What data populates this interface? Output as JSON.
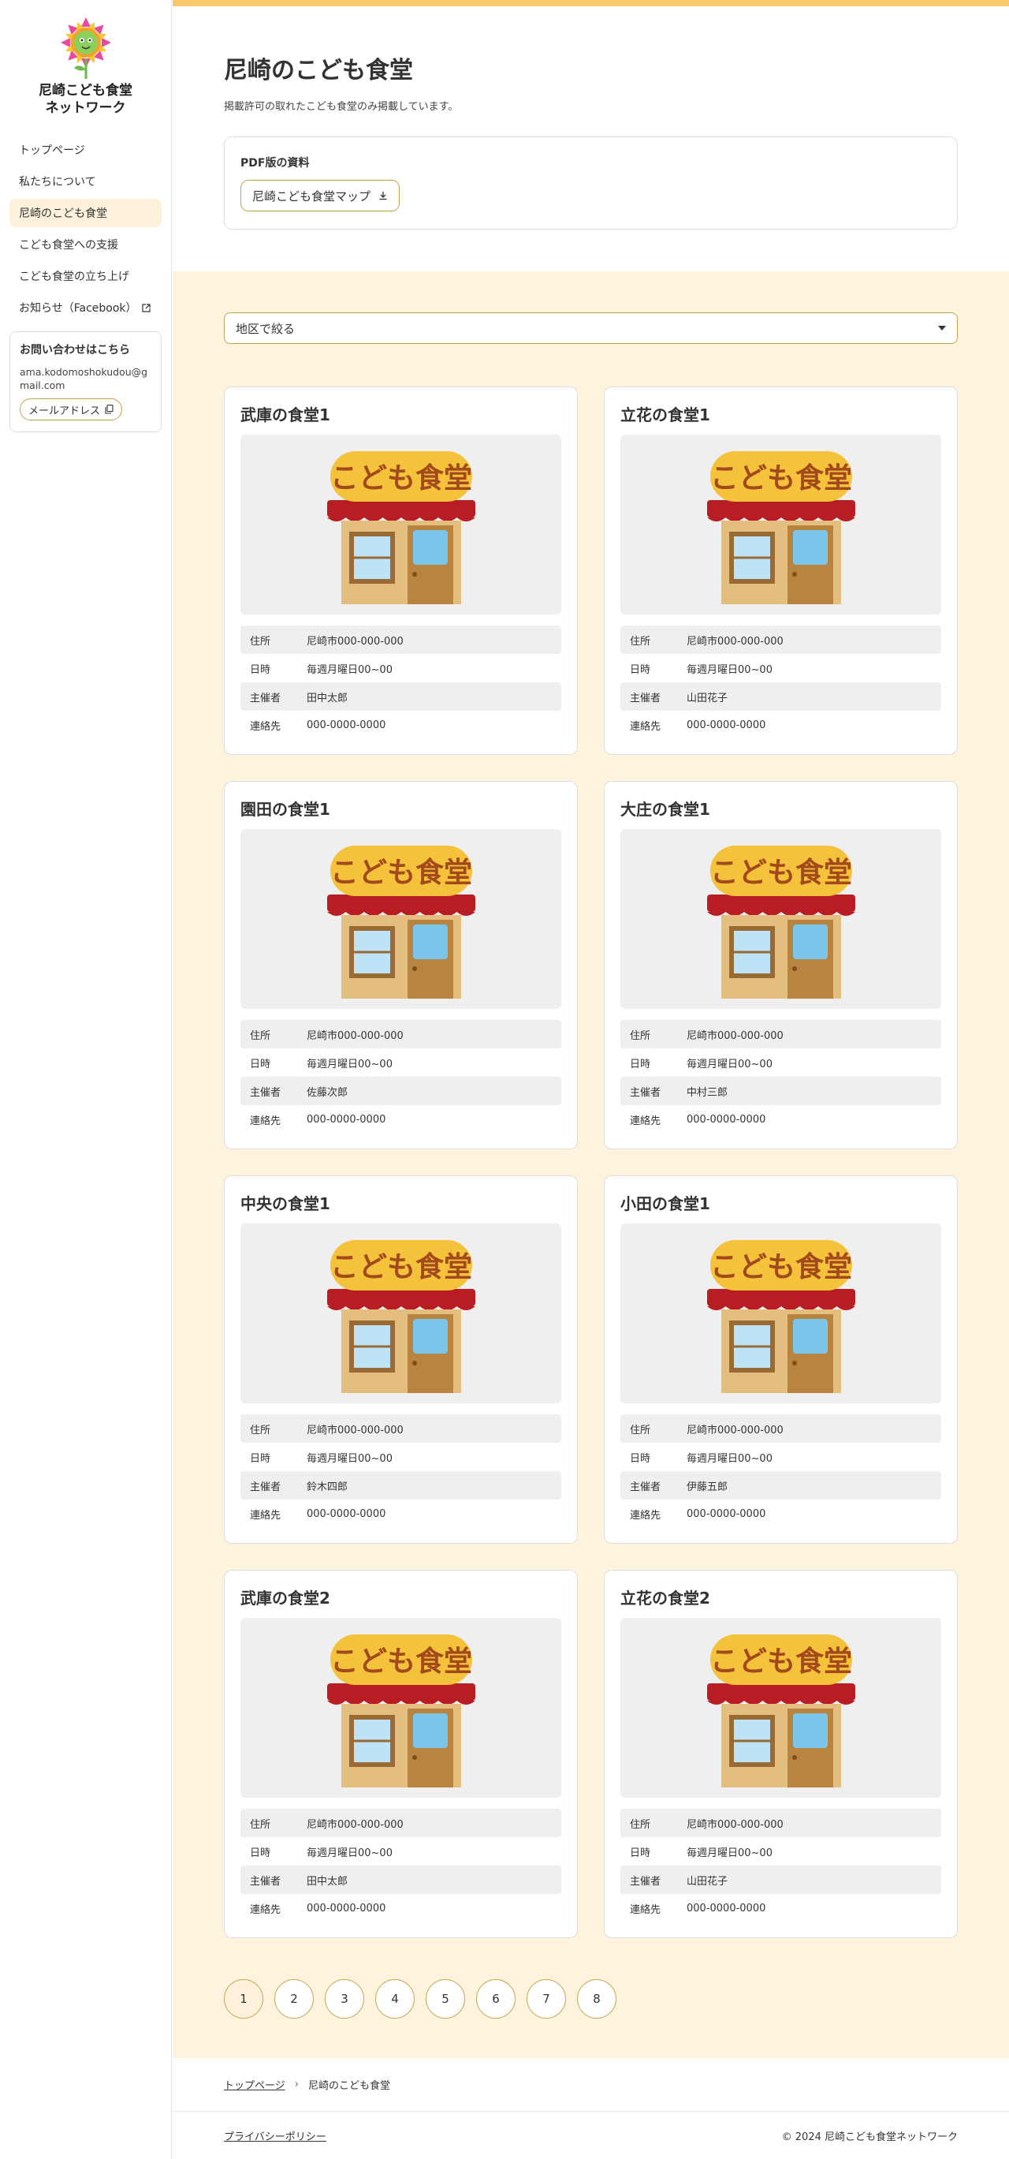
{
  "site": {
    "title_line1": "尼崎こども食堂",
    "title_line2": "ネットワーク"
  },
  "nav": [
    {
      "label": "トップページ",
      "active": false
    },
    {
      "label": "私たちについて",
      "active": false
    },
    {
      "label": "尼崎のこども食堂",
      "active": true
    },
    {
      "label": "こども食堂への支援",
      "active": false
    },
    {
      "label": "こども食堂の立ち上げ",
      "active": false
    },
    {
      "label": "お知らせ（Facebook）",
      "active": false,
      "external": true
    }
  ],
  "contact": {
    "title": "お問い合わせはこちら",
    "email": "ama.kodomoshokudou@gmail.com",
    "copy_label": "メールアドレス"
  },
  "page": {
    "title": "尼崎のこども食堂",
    "description": "掲載許可の取れたこども食堂のみ掲載しています。"
  },
  "pdf": {
    "label": "PDF版の資料",
    "button": "尼崎こども食堂マップ"
  },
  "filter": {
    "label": "地区で絞る"
  },
  "labels": {
    "address": "住所",
    "datetime": "日時",
    "organizer": "主催者",
    "contact": "連絡先"
  },
  "sign_text": "こども食堂",
  "cards": [
    {
      "title": "武庫の食堂1",
      "address": "尼崎市000-000-000",
      "datetime": "毎週月曜日00~00",
      "organizer": "田中太郎",
      "contact": "000-0000-0000"
    },
    {
      "title": "立花の食堂1",
      "address": "尼崎市000-000-000",
      "datetime": "毎週月曜日00~00",
      "organizer": "山田花子",
      "contact": "000-0000-0000"
    },
    {
      "title": "園田の食堂1",
      "address": "尼崎市000-000-000",
      "datetime": "毎週月曜日00~00",
      "organizer": "佐藤次郎",
      "contact": "000-0000-0000"
    },
    {
      "title": "大庄の食堂1",
      "address": "尼崎市000-000-000",
      "datetime": "毎週月曜日00~00",
      "organizer": "中村三郎",
      "contact": "000-0000-0000"
    },
    {
      "title": "中央の食堂1",
      "address": "尼崎市000-000-000",
      "datetime": "毎週月曜日00~00",
      "organizer": "鈴木四郎",
      "contact": "000-0000-0000"
    },
    {
      "title": "小田の食堂1",
      "address": "尼崎市000-000-000",
      "datetime": "毎週月曜日00~00",
      "organizer": "伊藤五郎",
      "contact": "000-0000-0000"
    },
    {
      "title": "武庫の食堂2",
      "address": "尼崎市000-000-000",
      "datetime": "毎週月曜日00~00",
      "organizer": "田中太郎",
      "contact": "000-0000-0000"
    },
    {
      "title": "立花の食堂2",
      "address": "尼崎市000-000-000",
      "datetime": "毎週月曜日00~00",
      "organizer": "山田花子",
      "contact": "000-0000-0000"
    }
  ],
  "pagination": [
    "1",
    "2",
    "3",
    "4",
    "5",
    "6",
    "7",
    "8"
  ],
  "current_page": "1",
  "breadcrumb": {
    "home": "トップページ",
    "separator": "›",
    "current": "尼崎のこども食堂"
  },
  "footer": {
    "privacy": "プライバシーポリシー",
    "copyright": "© 2024 尼崎こども食堂ネットワーク"
  },
  "colors": {
    "accent": "#f9c86b",
    "accent_border": "#c8a24e",
    "light_bg": "#fef3dd",
    "active_nav": "#fdf1dc"
  }
}
